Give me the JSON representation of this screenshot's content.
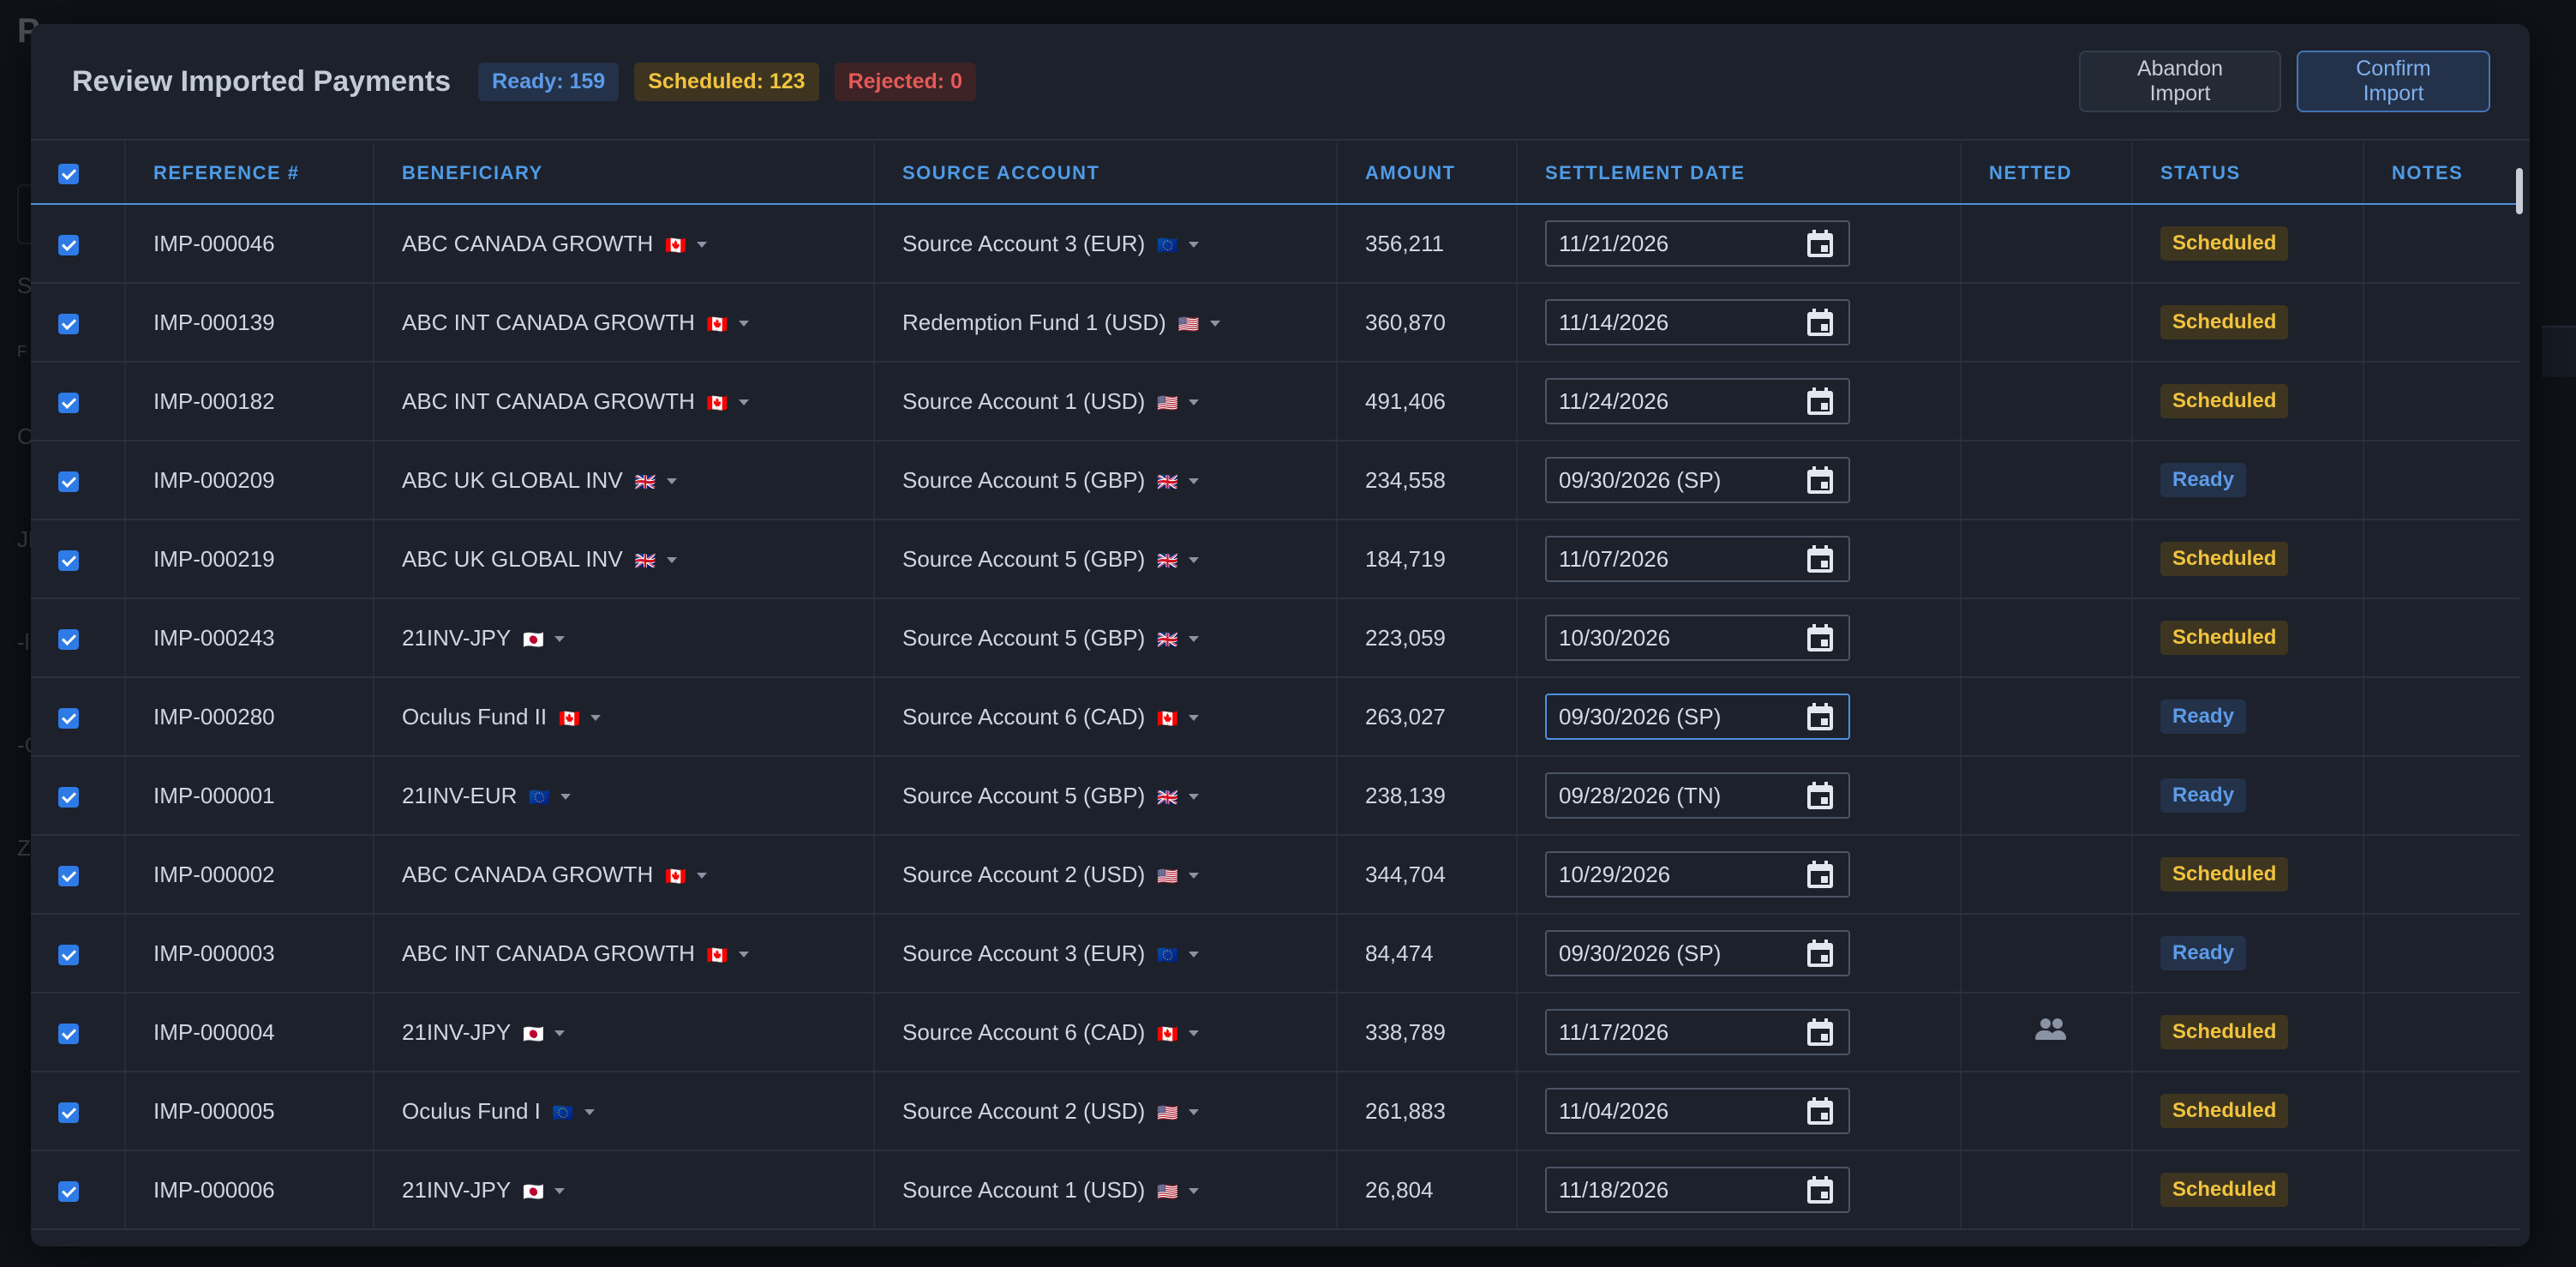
{
  "background": {
    "title": "P",
    "fragments": [
      "S",
      "F",
      "CA",
      "JL",
      "-l",
      "-C",
      "ZA"
    ]
  },
  "modal": {
    "title": "Review Imported Payments",
    "badges": {
      "ready": "Ready: 159",
      "scheduled": "Scheduled: 123",
      "rejected": "Rejected: 0"
    },
    "abandon_label": "Abandon Import",
    "confirm_label": "Confirm Import"
  },
  "table": {
    "columns": [
      "REFERENCE #",
      "BENEFICIARY",
      "SOURCE ACCOUNT",
      "AMOUNT",
      "SETTLEMENT DATE",
      "NETTED",
      "STATUS",
      "NOTES"
    ],
    "rows": [
      {
        "ref": "IMP-000046",
        "beneficiary": "ABC CANADA GROWTH",
        "bflag": "🇨🇦",
        "account": "Source Account 3 (EUR)",
        "aflag": "🇪🇺",
        "amount": "356,211",
        "date": "11/21/2026",
        "netted": false,
        "status": "Scheduled"
      },
      {
        "ref": "IMP-000139",
        "beneficiary": "ABC INT CANADA GROWTH",
        "bflag": "🇨🇦",
        "account": "Redemption Fund 1 (USD)",
        "aflag": "🇺🇸",
        "amount": "360,870",
        "date": "11/14/2026",
        "netted": false,
        "status": "Scheduled"
      },
      {
        "ref": "IMP-000182",
        "beneficiary": "ABC INT CANADA GROWTH",
        "bflag": "🇨🇦",
        "account": "Source Account 1 (USD)",
        "aflag": "🇺🇸",
        "amount": "491,406",
        "date": "11/24/2026",
        "netted": false,
        "status": "Scheduled"
      },
      {
        "ref": "IMP-000209",
        "beneficiary": "ABC UK GLOBAL INV",
        "bflag": "🇬🇧",
        "account": "Source Account 5 (GBP)",
        "aflag": "🇬🇧",
        "amount": "234,558",
        "date": "09/30/2026 (SP)",
        "netted": false,
        "status": "Ready"
      },
      {
        "ref": "IMP-000219",
        "beneficiary": "ABC UK GLOBAL INV",
        "bflag": "🇬🇧",
        "account": "Source Account 5 (GBP)",
        "aflag": "🇬🇧",
        "amount": "184,719",
        "date": "11/07/2026",
        "netted": false,
        "status": "Scheduled"
      },
      {
        "ref": "IMP-000243",
        "beneficiary": "21INV-JPY",
        "bflag": "🇯🇵",
        "account": "Source Account 5 (GBP)",
        "aflag": "🇬🇧",
        "amount": "223,059",
        "date": "10/30/2026",
        "netted": false,
        "status": "Scheduled"
      },
      {
        "ref": "IMP-000280",
        "beneficiary": "Oculus Fund II",
        "bflag": "🇨🇦",
        "account": "Source Account 6 (CAD)",
        "aflag": "🇨🇦",
        "amount": "263,027",
        "date": "09/30/2026 (SP)",
        "netted": false,
        "status": "Ready"
      },
      {
        "ref": "IMP-000001",
        "beneficiary": "21INV-EUR",
        "bflag": "🇪🇺",
        "account": "Source Account 5 (GBP)",
        "aflag": "🇬🇧",
        "amount": "238,139",
        "date": "09/28/2026 (TN)",
        "netted": false,
        "status": "Ready"
      },
      {
        "ref": "IMP-000002",
        "beneficiary": "ABC CANADA GROWTH",
        "bflag": "🇨🇦",
        "account": "Source Account 2 (USD)",
        "aflag": "🇺🇸",
        "amount": "344,704",
        "date": "10/29/2026",
        "netted": false,
        "status": "Scheduled"
      },
      {
        "ref": "IMP-000003",
        "beneficiary": "ABC INT CANADA GROWTH",
        "bflag": "🇨🇦",
        "account": "Source Account 3 (EUR)",
        "aflag": "🇪🇺",
        "amount": "84,474",
        "date": "09/30/2026 (SP)",
        "netted": false,
        "status": "Ready"
      },
      {
        "ref": "IMP-000004",
        "beneficiary": "21INV-JPY",
        "bflag": "🇯🇵",
        "account": "Source Account 6 (CAD)",
        "aflag": "🇨🇦",
        "amount": "338,789",
        "date": "11/17/2026",
        "netted": true,
        "status": "Scheduled"
      },
      {
        "ref": "IMP-000005",
        "beneficiary": "Oculus Fund I",
        "bflag": "🇪🇺",
        "account": "Source Account 2 (USD)",
        "aflag": "🇺🇸",
        "amount": "261,883",
        "date": "11/04/2026",
        "netted": false,
        "status": "Scheduled"
      },
      {
        "ref": "IMP-000006",
        "beneficiary": "21INV-JPY",
        "bflag": "🇯🇵",
        "account": "Source Account 1 (USD)",
        "aflag": "🇺🇸",
        "amount": "26,804",
        "date": "11/18/2026",
        "netted": false,
        "status": "Scheduled"
      }
    ],
    "focused_row": 6
  },
  "icons": {
    "calendar": "calendar-icon",
    "netted": "people-icon",
    "dropdown": "chevron-down-icon"
  },
  "colors": {
    "accent": "#4f9be6",
    "ready": "#5d9be8",
    "scheduled": "#f1c33e",
    "rejected": "#e35a58"
  }
}
